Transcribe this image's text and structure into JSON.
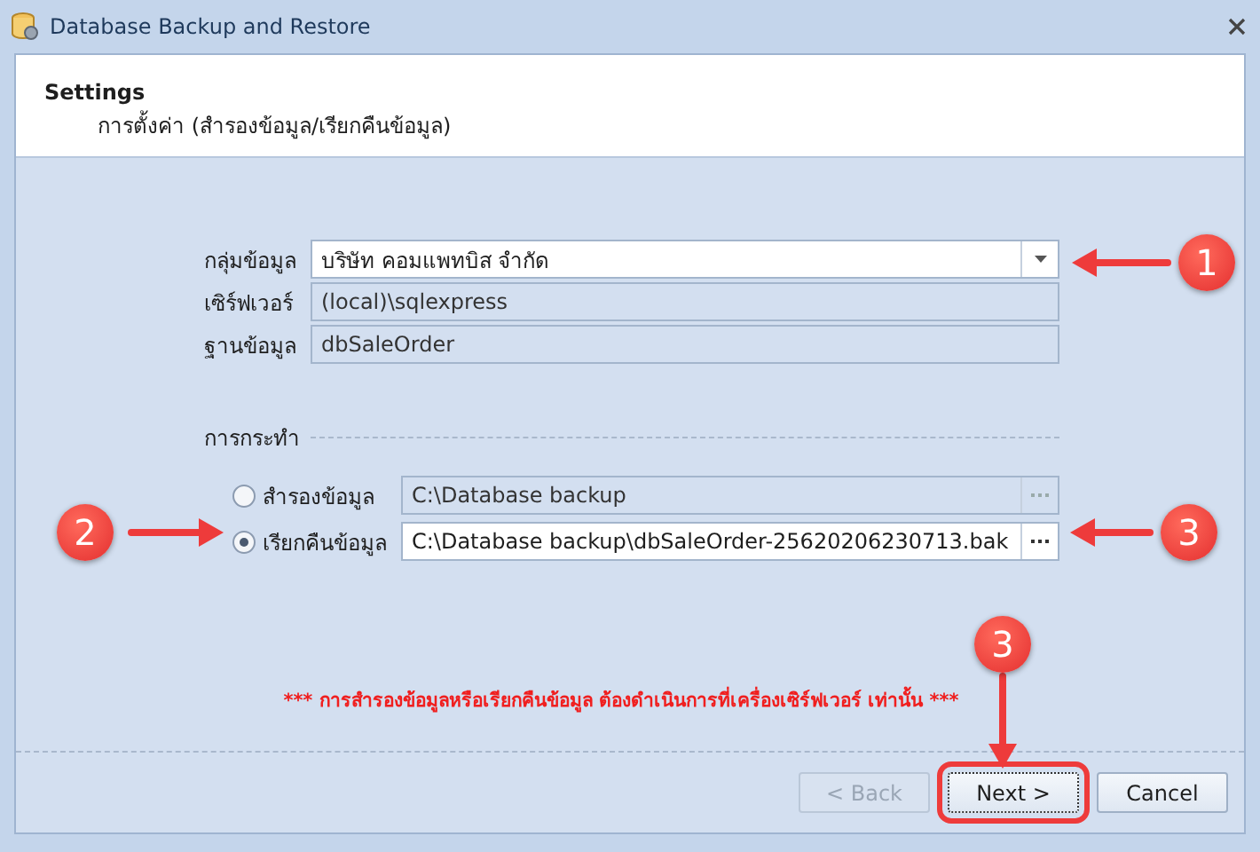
{
  "window": {
    "title": "Database Backup and Restore"
  },
  "header": {
    "title": "Settings",
    "subtitle": "การตั้งค่า (สำรองข้อมูล/เรียกคืนข้อมูล)"
  },
  "fields": [
    {
      "kind": "dropdown",
      "label": "กลุ่มข้อมูล",
      "value": "บริษัท คอมแพทบิส จำกัด",
      "disabled": false
    },
    {
      "kind": "text",
      "label": "เซิร์ฟเวอร์",
      "value": "(local)\\sqlexpress",
      "disabled": true
    },
    {
      "kind": "text",
      "label": "ฐานข้อมูล",
      "value": "dbSaleOrder",
      "disabled": true
    }
  ],
  "action": {
    "title": "การกระทำ",
    "options": [
      {
        "label": "สำรองข้อมูล",
        "path": "C:\\Database backup",
        "selected": false
      },
      {
        "label": "เรียกคืนข้อมูล",
        "path": "C:\\Database backup\\dbSaleOrder-25620206230713.bak",
        "selected": true
      }
    ]
  },
  "warning": "*** การสำรองข้อมูลหรือเรียกคืนข้อมูล ต้องดำเนินการที่เครื่องเซิร์ฟเวอร์ เท่านั้น ***",
  "buttons": [
    {
      "label": "< Back",
      "disabled": true,
      "highlighted": false
    },
    {
      "label": "Next >",
      "disabled": false,
      "highlighted": true
    },
    {
      "label": "Cancel",
      "disabled": false,
      "highlighted": false
    }
  ],
  "annotations": [
    {
      "number": "1"
    },
    {
      "number": "2"
    },
    {
      "number": "3"
    },
    {
      "number": "3"
    }
  ]
}
